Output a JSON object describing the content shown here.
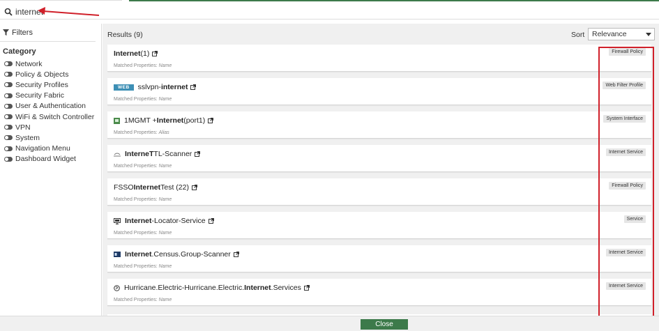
{
  "search": {
    "value": "internet"
  },
  "filters": {
    "title": "Filters",
    "category_title": "Category",
    "categories": [
      "Network",
      "Policy & Objects",
      "Security Profiles",
      "Security Fabric",
      "User & Authentication",
      "WiFi & Switch Controller",
      "VPN",
      "System",
      "Navigation Menu",
      "Dashboard Widget"
    ]
  },
  "results": {
    "title": "Results (9)",
    "sort_label": "Sort",
    "sort_value": "Relevance",
    "matched_label": "Matched Properties:",
    "items": [
      {
        "pre": "",
        "bold": "Internet",
        "post": " (1)",
        "prop": "Name",
        "badge": "Firewall Policy"
      },
      {
        "tag": "WEB",
        "pre": "sslvpn-",
        "bold": "internet",
        "post": "",
        "prop": "Name",
        "badge": "Web Filter Profile"
      },
      {
        "pre": "1MGMT + ",
        "bold": "Internet",
        "post": " (port1)",
        "prop": "Alias",
        "badge": "System Interface"
      },
      {
        "pre": "",
        "bold": "InterneT",
        "post": "TL-Scanner",
        "prop": "Name",
        "badge": "Internet Service"
      },
      {
        "pre": "FSSO ",
        "bold": "Internet",
        "post": " Test (22)",
        "prop": "Name",
        "badge": "Firewall Policy"
      },
      {
        "pre": "",
        "bold": "Internet",
        "post": "-Locator-Service",
        "prop": "Name",
        "badge": "Service"
      },
      {
        "pre": "",
        "bold": "Internet",
        "post": ".Census.Group-Scanner",
        "prop": "Name",
        "badge": "Internet Service"
      },
      {
        "pre": "Hurricane.Electric-Hurricane.Electric.",
        "bold": "Internet",
        "post": ".Services",
        "prop": "Name",
        "badge": "Internet Service"
      }
    ]
  },
  "footer": {
    "close_label": "Close"
  },
  "colors": {
    "accent_green": "#3c7a4a",
    "highlight_red": "#d0202a",
    "web_tag": "#3d8fb5"
  }
}
